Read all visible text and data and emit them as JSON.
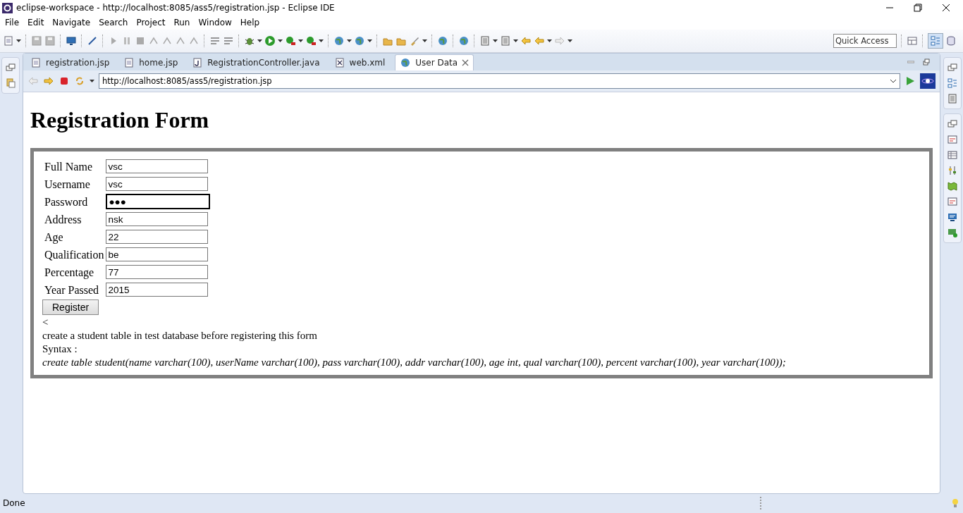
{
  "window": {
    "title": "eclipse-workspace - http://localhost:8085/ass5/registration.jsp - Eclipse IDE"
  },
  "menu": [
    "File",
    "Edit",
    "Navigate",
    "Search",
    "Project",
    "Run",
    "Window",
    "Help"
  ],
  "quick_access": {
    "placeholder": "Quick Access"
  },
  "tabs": [
    {
      "label": "registration.jsp",
      "kind": "jsp",
      "selected": false
    },
    {
      "label": "home.jsp",
      "kind": "jsp",
      "selected": false
    },
    {
      "label": "RegistrationController.java",
      "kind": "java",
      "selected": false
    },
    {
      "label": "web.xml",
      "kind": "xml",
      "selected": false
    },
    {
      "label": "User Data",
      "kind": "web",
      "selected": true
    }
  ],
  "browser": {
    "url": "http://localhost:8085/ass5/registration.jsp"
  },
  "page": {
    "heading": "Registration Form",
    "fields": [
      {
        "label": "Full Name",
        "value": "vsc",
        "focused": false
      },
      {
        "label": "Username",
        "value": "vsc",
        "focused": false
      },
      {
        "label": "Password",
        "value": "●●●",
        "focused": true
      },
      {
        "label": "Address",
        "value": "nsk",
        "focused": false
      },
      {
        "label": "Age",
        "value": "22",
        "focused": false
      },
      {
        "label": "Qualification",
        "value": "be",
        "focused": false
      },
      {
        "label": "Percentage",
        "value": "77",
        "focused": false
      },
      {
        "label": "Year Passed",
        "value": "2015",
        "focused": false
      }
    ],
    "button": "Register",
    "stray_text": "<",
    "note": "create a student table in test database before registering this form",
    "syntax_label": "Syntax :",
    "syntax": "create table student(name varchar(100), userName varchar(100), pass varchar(100), addr varchar(100), age int, qual varchar(100), percent varchar(100), year varchar(100));"
  },
  "status_bar": {
    "text": "Done"
  }
}
